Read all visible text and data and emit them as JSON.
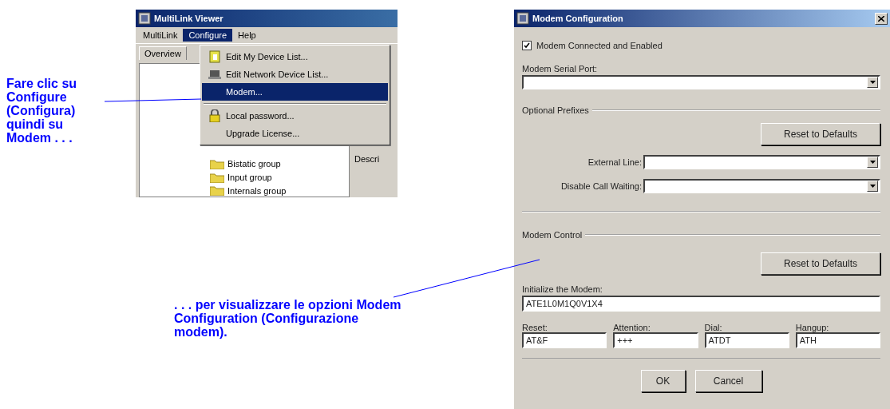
{
  "callouts": [
    {
      "text": "Fare clic su Configure (Configura) quindi su Modem . . ."
    },
    {
      "text": ". . . per visualizzare le opzioni Modem Configuration (Configurazione modem)."
    }
  ],
  "viewer": {
    "title": "MultiLink Viewer",
    "menus": [
      {
        "label": "MultiLink",
        "selected": false
      },
      {
        "label": "Configure",
        "selected": true
      },
      {
        "label": "Help",
        "selected": false
      }
    ],
    "toolbar_tab": "Overview",
    "tree": [
      "Bistatic group",
      "Input group",
      "Internals group"
    ],
    "side_text": "Descri",
    "menu_items": [
      {
        "kind": "item",
        "label": "Edit My Device List...",
        "selected": false
      },
      {
        "kind": "item",
        "label": "Edit Network Device List...",
        "selected": false
      },
      {
        "kind": "item",
        "label": "Modem...",
        "selected": true
      },
      {
        "kind": "separator"
      },
      {
        "kind": "item",
        "label": "Local password...",
        "selected": false
      },
      {
        "kind": "item",
        "label": "Upgrade License...",
        "selected": false
      }
    ]
  },
  "dialog": {
    "title": "Modem Configuration",
    "enabled": {
      "label": "Modem Connected and Enabled",
      "checked": true
    },
    "serial_port": {
      "label": "Modem Serial Port:"
    },
    "prefixes": {
      "title": "Optional Prefixes",
      "reset": "Reset to Defaults",
      "fields": [
        {
          "label": "External Line:"
        },
        {
          "label": "Disable Call Waiting:"
        }
      ]
    },
    "control": {
      "title": "Modem Control",
      "reset": "Reset to Defaults",
      "init_label": "Initialize the Modem:",
      "init_value": "ATE1L0M1Q0V1X4",
      "fields": [
        {
          "label": "Reset:",
          "value": "AT&F"
        },
        {
          "label": "Attention:",
          "value": "+++"
        },
        {
          "label": "Dial:",
          "value": "ATDT"
        },
        {
          "label": "Hangup:",
          "value": "ATH"
        }
      ]
    },
    "buttons": [
      "OK",
      "Cancel"
    ]
  }
}
